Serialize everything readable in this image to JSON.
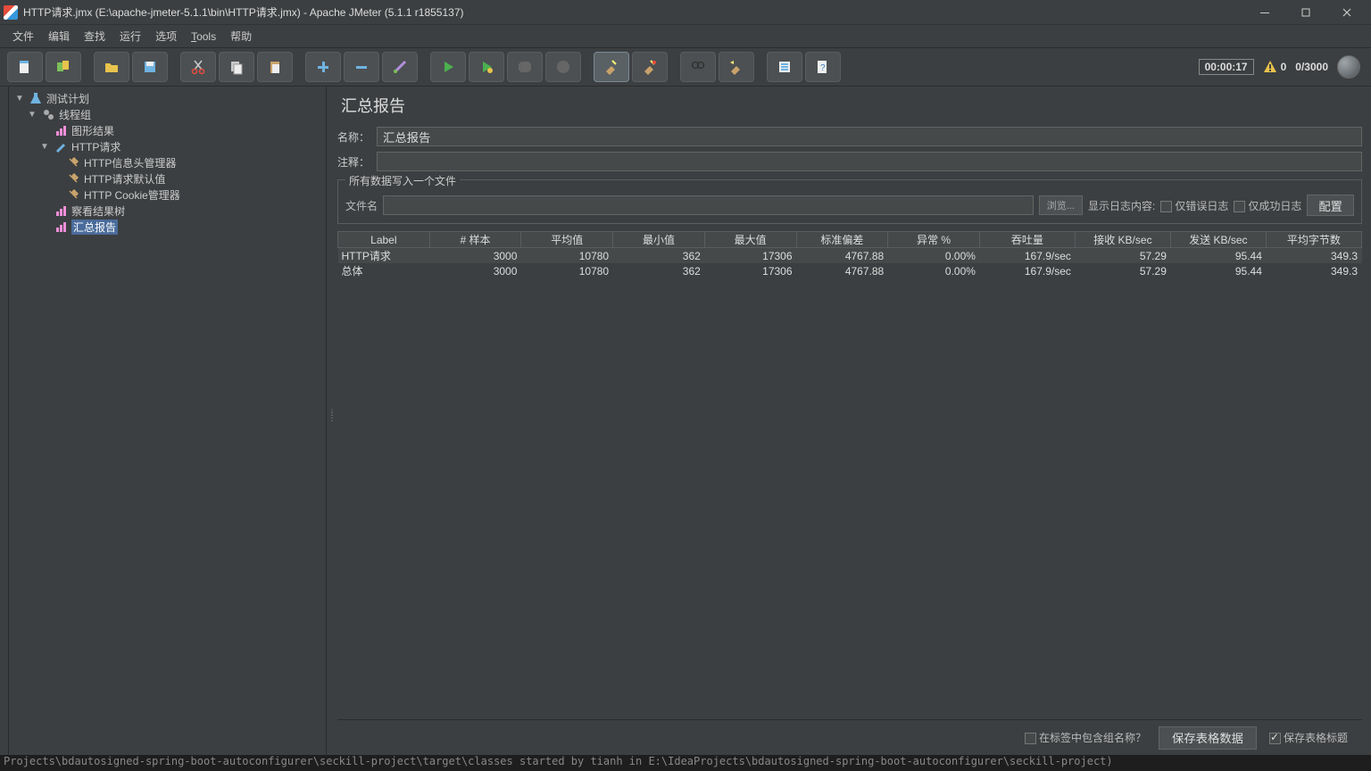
{
  "titlebar": {
    "title": "HTTP请求.jmx (E:\\apache-jmeter-5.1.1\\bin\\HTTP请求.jmx) - Apache JMeter (5.1.1 r1855137)"
  },
  "menu": {
    "file": "文件",
    "edit": "编辑",
    "search": "查找",
    "run": "运行",
    "options": "选项",
    "tools": "Tools",
    "help": "帮助"
  },
  "toolbar": {
    "timer": "00:00:17",
    "warn_count": "0",
    "thread_count": "0/3000"
  },
  "tree": {
    "test_plan": "测试计划",
    "thread_group": "线程组",
    "graph_result": "图形结果",
    "http_request": "HTTP请求",
    "header_mgr": "HTTP信息头管理器",
    "request_defaults": "HTTP请求默认值",
    "cookie_mgr": "HTTP Cookie管理器",
    "view_results_tree": "察看结果树",
    "summary_report": "汇总报告"
  },
  "page": {
    "title": "汇总报告",
    "name_label": "名称：",
    "name_value": "汇总报告",
    "comment_label": "注释：",
    "comment_value": "",
    "write_all_legend": "所有数据写入一个文件",
    "filename_label": "文件名",
    "filename_value": "",
    "browse_btn": "浏览...",
    "show_log_label": "显示日志内容:",
    "only_error_label": "仅错误日志",
    "only_success_label": "仅成功日志",
    "configure_btn": "配置"
  },
  "table": {
    "headers": [
      "Label",
      "# 样本",
      "平均值",
      "最小值",
      "最大值",
      "标准偏差",
      "异常 %",
      "吞吐量",
      "接收 KB/sec",
      "发送 KB/sec",
      "平均字节数"
    ],
    "rows": [
      {
        "label": "HTTP请求",
        "samples": "3000",
        "avg": "10780",
        "min": "362",
        "max": "17306",
        "stddev": "4767.88",
        "errpct": "0.00%",
        "throughput": "167.9/sec",
        "recvkb": "57.29",
        "sentkb": "95.44",
        "avgbytes": "349.3"
      },
      {
        "label": "总体",
        "samples": "3000",
        "avg": "10780",
        "min": "362",
        "max": "17306",
        "stddev": "4767.88",
        "errpct": "0.00%",
        "throughput": "167.9/sec",
        "recvkb": "57.29",
        "sentkb": "95.44",
        "avgbytes": "349.3"
      }
    ]
  },
  "footer": {
    "include_group_label": "在标签中包含组名称？",
    "save_table_btn": "保存表格数据",
    "save_header_label": "保存表格标题"
  },
  "console": "Projects\\bdautosigned-spring-boot-autoconfigurer\\seckill-project\\target\\classes started by tianh in E:\\IdeaProjects\\bdautosigned-spring-boot-autoconfigurer\\seckill-project)"
}
